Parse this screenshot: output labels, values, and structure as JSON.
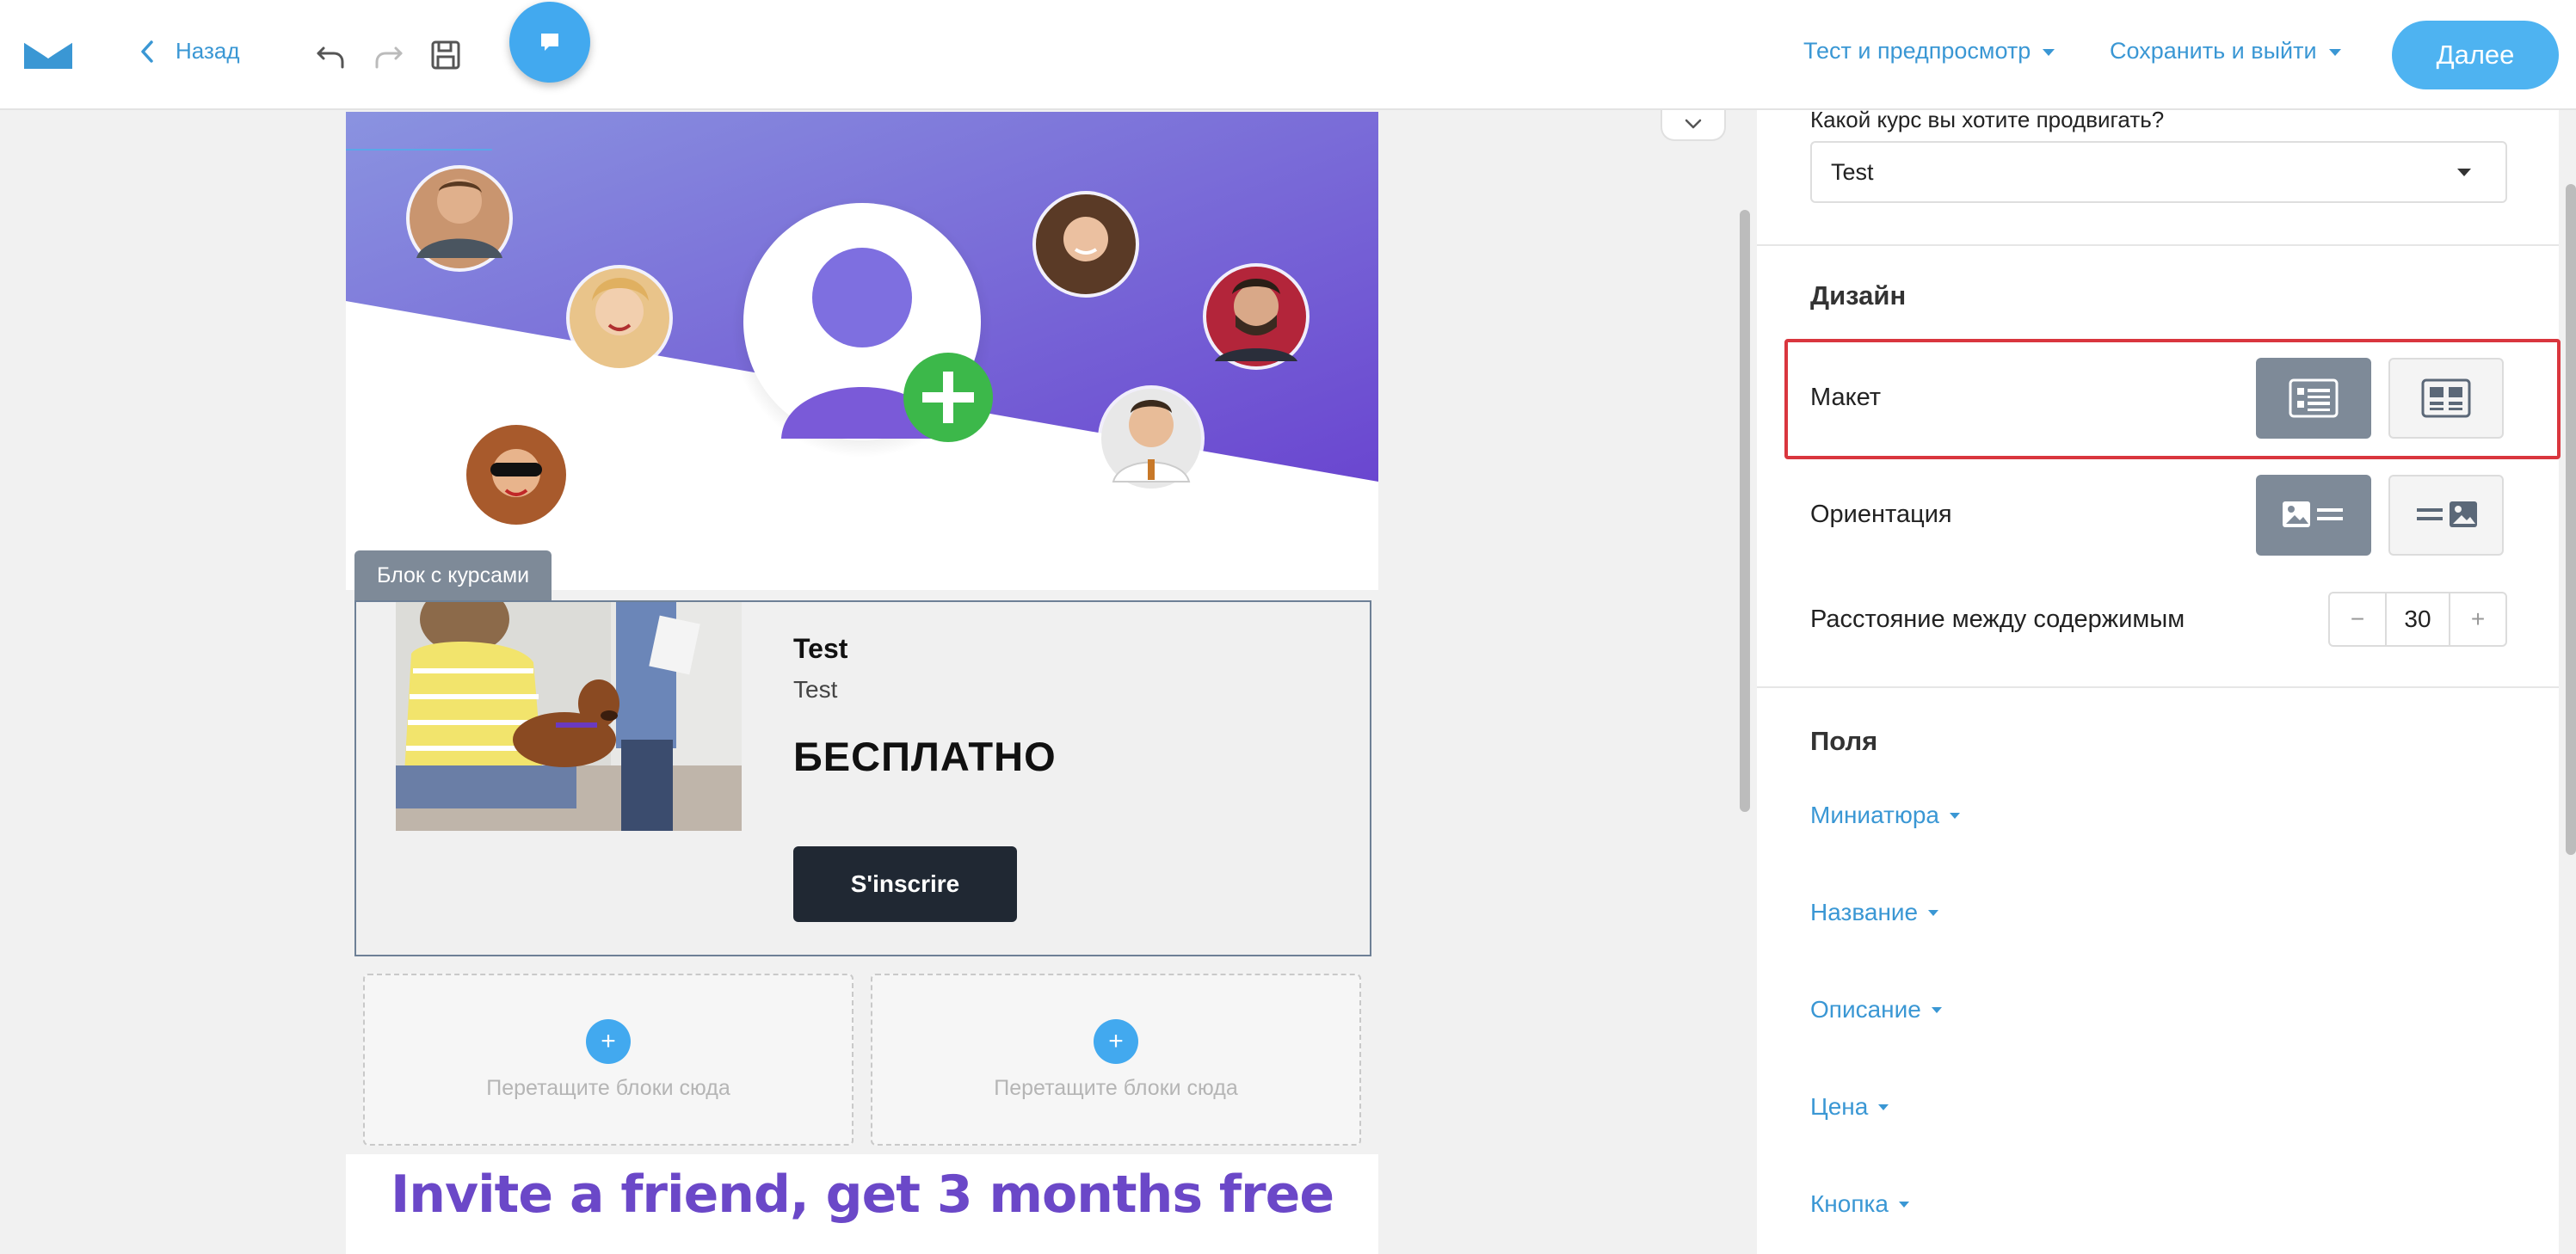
{
  "topbar": {
    "back_label": "Назад",
    "test_preview_label": "Тест и предпросмотр",
    "save_exit_label": "Сохранить и выйти",
    "next_label": "Далее"
  },
  "canvas": {
    "course_block_tag": "Блок с курсами",
    "course": {
      "title": "Test",
      "description": "Test",
      "price": "БЕСПЛАТНО",
      "button_label": "S'inscrire"
    },
    "dropzones": [
      {
        "text": "Перетащите блоки сюда"
      },
      {
        "text": "Перетащите блоки сюда"
      }
    ],
    "invite_text": "Invite a friend, get 3 months free"
  },
  "panel": {
    "course_question": "Какой курс вы хотите продвигать?",
    "course_select_value": "Test",
    "design_title": "Дизайн",
    "layout_label": "Макет",
    "orientation_label": "Ориентация",
    "spacing_label": "Расстояние между содержимым",
    "spacing_value": "30",
    "fields_title": "Поля",
    "fields": [
      {
        "label": "Миниатюра"
      },
      {
        "label": "Название"
      },
      {
        "label": "Описание"
      },
      {
        "label": "Цена"
      },
      {
        "label": "Кнопка"
      }
    ]
  },
  "colors": {
    "accent": "#42a9ef",
    "link": "#3a97d4",
    "highlight": "#d9363e",
    "hero_purple": "#6f4fd0"
  }
}
